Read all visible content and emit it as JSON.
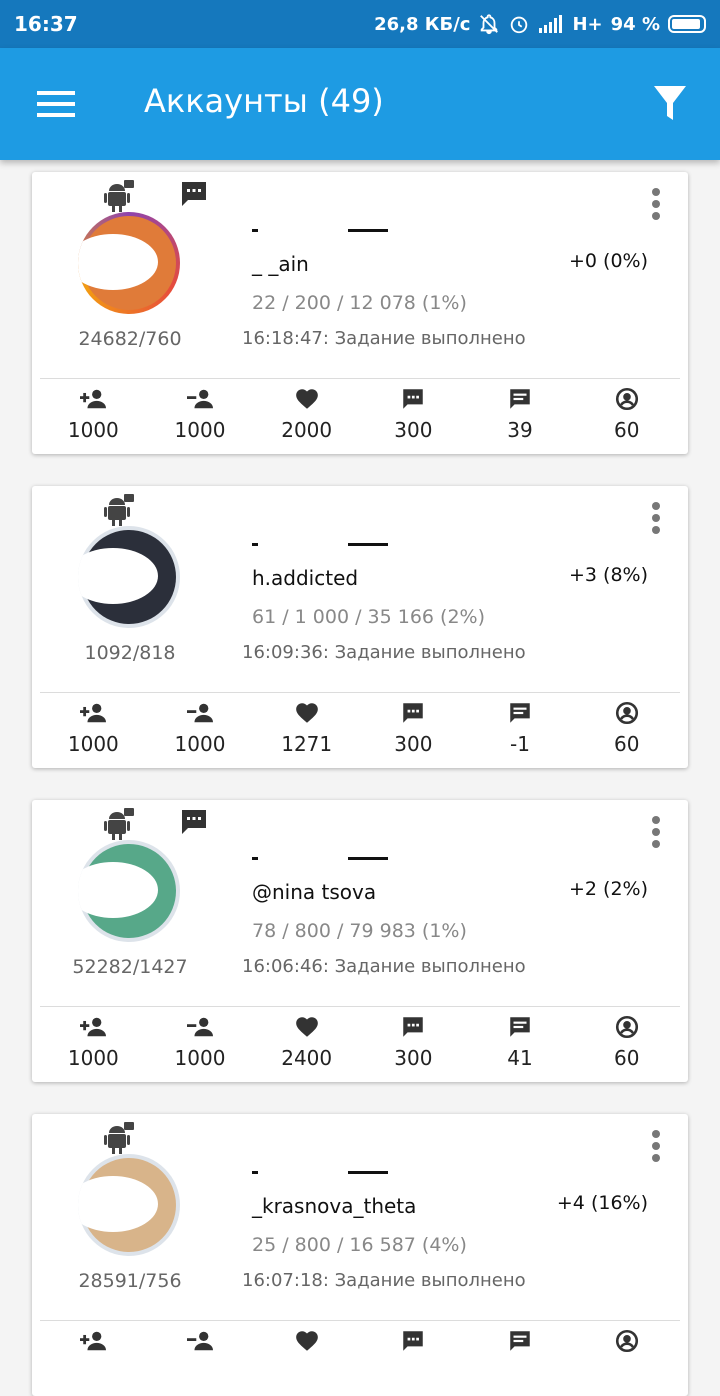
{
  "status_bar": {
    "time": "16:37",
    "net_speed": "26,8 КБ/с",
    "network": "H+",
    "battery_label": "94 %",
    "battery_level": 0.94
  },
  "app_bar": {
    "title": "Аккаунты (49)"
  },
  "accounts": [
    {
      "counts": "24682/760",
      "username": "_ _ain",
      "growth": "+0 (0%)",
      "stats": "22 / 200 / 12 078 (1%)",
      "task": "16:18:47: Задание выполнено",
      "metrics": {
        "follow": "1000",
        "unfollow": "1000",
        "likes": "2000",
        "comments": "300",
        "direct": "39",
        "limit": "60"
      }
    },
    {
      "counts": "1092/818",
      "username": "h.addicted",
      "growth": "+3 (8%)",
      "stats": "61 / 1 000 / 35 166 (2%)",
      "task": "16:09:36: Задание выполнено",
      "metrics": {
        "follow": "1000",
        "unfollow": "1000",
        "likes": "1271",
        "comments": "300",
        "direct": "-1",
        "limit": "60"
      }
    },
    {
      "counts": "52282/1427",
      "username": "@nina  tsova",
      "growth": "+2 (2%)",
      "stats": "78 / 800 / 79 983 (1%)",
      "task": "16:06:46: Задание выполнено",
      "metrics": {
        "follow": "1000",
        "unfollow": "1000",
        "likes": "2400",
        "comments": "300",
        "direct": "41",
        "limit": "60"
      }
    },
    {
      "counts": "28591/756",
      "username": "_krasnova_theta",
      "growth": "+4 (16%)",
      "stats": "25 / 800 / 16 587 (4%)",
      "task": "16:07:18: Задание выполнено",
      "metrics": {
        "follow": "",
        "unfollow": "",
        "likes": "",
        "comments": "",
        "direct": "",
        "limit": ""
      }
    }
  ],
  "colors": {
    "status_bar": "#1578bd",
    "app_bar": "#1e9be3",
    "icon_dark": "#333333"
  }
}
